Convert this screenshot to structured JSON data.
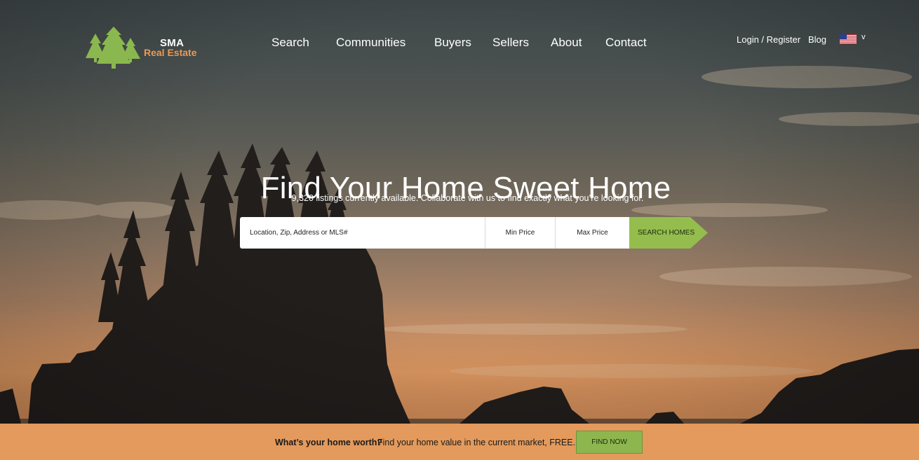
{
  "brand": {
    "line1": "SMA",
    "line2": "Real Estate",
    "accent_color": "#e89a55",
    "logo_icon": "pine-trees-icon",
    "tree_color": "#8bb84e"
  },
  "nav": {
    "items": [
      {
        "label": "Search"
      },
      {
        "label": "Communities"
      },
      {
        "label": "Buyers"
      },
      {
        "label": "Sellers"
      },
      {
        "label": "About"
      },
      {
        "label": "Contact"
      }
    ]
  },
  "utility": {
    "login": "Login / Register",
    "blog": "Blog",
    "language_icon": "us-flag-icon",
    "language_chevron": "v"
  },
  "hero": {
    "headline": "Find Your Home Sweet Home",
    "subline": "9,320 listings currently available. Collaborate with us to find exactly what you’re looking for."
  },
  "search": {
    "location_label": "Location, Zip, Address or MLS#",
    "min_price": "Min Price",
    "max_price": "Max Price",
    "button": "SEARCH HOMES",
    "button_color": "#94bd4d"
  },
  "cta": {
    "question": "What’s your home worth?",
    "text": "Find your home value in the current market, FREE.",
    "button": "FIND NOW",
    "bar_color": "#e39a5c"
  }
}
